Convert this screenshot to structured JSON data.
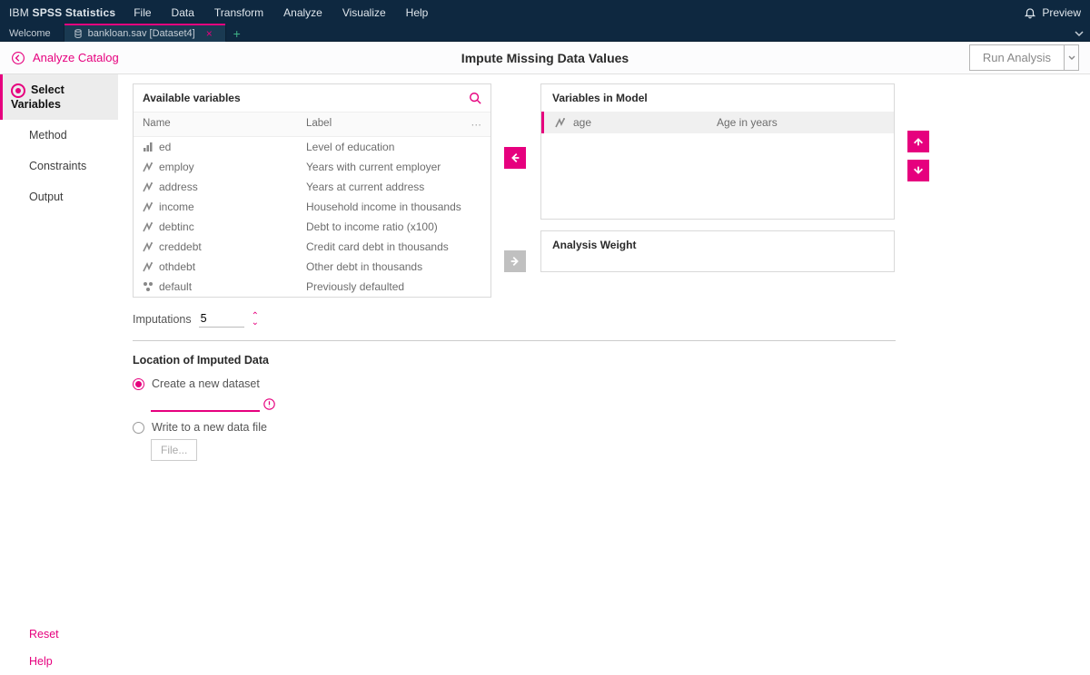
{
  "brand": {
    "p1": "IBM",
    "p2": "SPSS Statistics"
  },
  "menu": {
    "file": "File",
    "data": "Data",
    "transform": "Transform",
    "analyze": "Analyze",
    "visualize": "Visualize",
    "help": "Help",
    "preview": "Preview"
  },
  "tabs": {
    "welcome": "Welcome",
    "active": "bankloan.sav [Dataset4]"
  },
  "catalog": {
    "back": "Analyze Catalog",
    "title": "Impute Missing Data Values",
    "run": "Run Analysis"
  },
  "sidebar": {
    "select": "Select Variables",
    "method": "Method",
    "constraints": "Constraints",
    "output": "Output",
    "reset": "Reset",
    "help": "Help"
  },
  "avail": {
    "title": "Available variables",
    "col_name": "Name",
    "col_label": "Label",
    "rows": [
      {
        "icon": "ordinal",
        "name": "ed",
        "label": "Level of education"
      },
      {
        "icon": "scale",
        "name": "employ",
        "label": "Years with current employer"
      },
      {
        "icon": "scale",
        "name": "address",
        "label": "Years at current address"
      },
      {
        "icon": "scale",
        "name": "income",
        "label": "Household income in thousands"
      },
      {
        "icon": "scale",
        "name": "debtinc",
        "label": "Debt to income ratio (x100)"
      },
      {
        "icon": "scale",
        "name": "creddebt",
        "label": "Credit card debt in thousands"
      },
      {
        "icon": "scale",
        "name": "othdebt",
        "label": "Other debt in thousands"
      },
      {
        "icon": "nominal",
        "name": "default",
        "label": "Previously defaulted"
      }
    ]
  },
  "model": {
    "title": "Variables in Model",
    "rows": [
      {
        "icon": "scale",
        "name": "age",
        "label": "Age in years"
      }
    ]
  },
  "analysis_weight": {
    "title": "Analysis Weight"
  },
  "imputations": {
    "label": "Imputations",
    "value": "5"
  },
  "location": {
    "title": "Location of Imputed Data",
    "opt1": "Create a new dataset",
    "opt2": "Write to a new data file",
    "filebtn": "File..."
  }
}
